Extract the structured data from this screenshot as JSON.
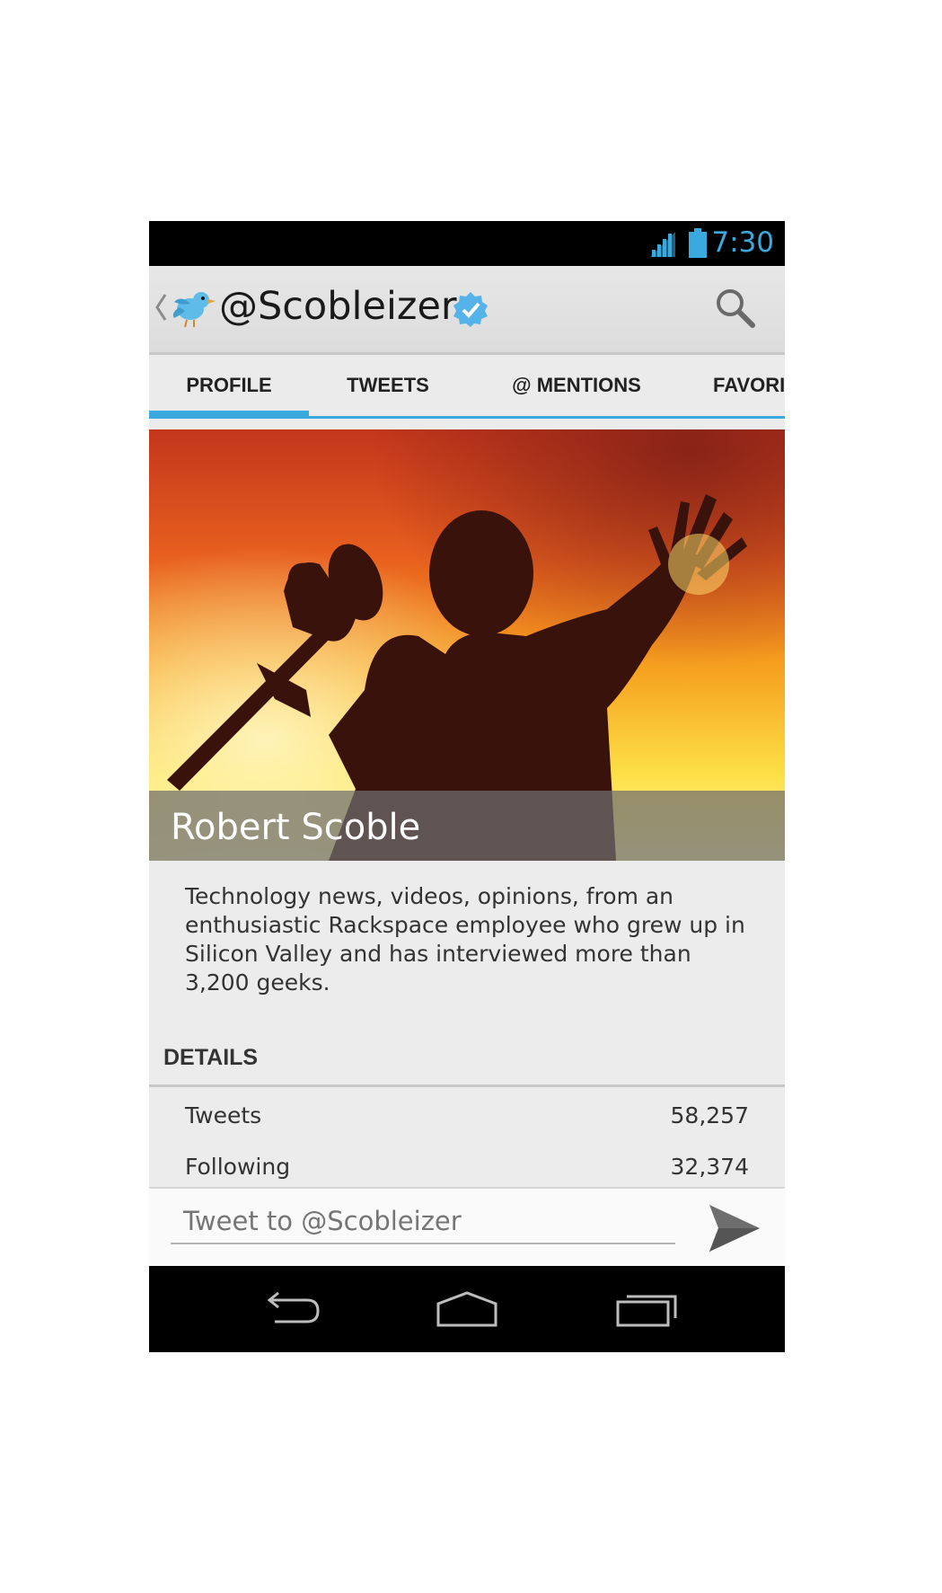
{
  "status_bar": {
    "time": "7:30",
    "accent_color": "#3aa9e0",
    "icons": [
      "signal-icon",
      "battery-icon"
    ]
  },
  "action_bar": {
    "title": "@Scobleizer",
    "icons": [
      "up-chevron-icon",
      "twitter-bird-icon",
      "verified-badge-icon",
      "search-icon"
    ]
  },
  "tabs": [
    {
      "label": "PROFILE",
      "active": true
    },
    {
      "label": "TWEETS",
      "active": false
    },
    {
      "label": "@ MENTIONS",
      "active": false
    },
    {
      "label": "FAVORI",
      "active": false
    }
  ],
  "profile": {
    "name": "Robert Scoble",
    "bio_lines": [
      "Technology news, videos, opinions, from an",
      "enthusiastic Rackspace employee who grew up in",
      "Silicon Valley and has interviewed more than",
      "3,200 geeks."
    ]
  },
  "details": {
    "heading": "DETAILS",
    "rows": [
      {
        "label": "Tweets",
        "value": "58,257"
      },
      {
        "label": "Following",
        "value": "32,374"
      }
    ]
  },
  "compose": {
    "placeholder": "Tweet to @Scobleizer",
    "icons": [
      "send-icon"
    ]
  },
  "nav_bar": {
    "icons": [
      "back-icon",
      "home-icon",
      "recent-apps-icon"
    ]
  }
}
